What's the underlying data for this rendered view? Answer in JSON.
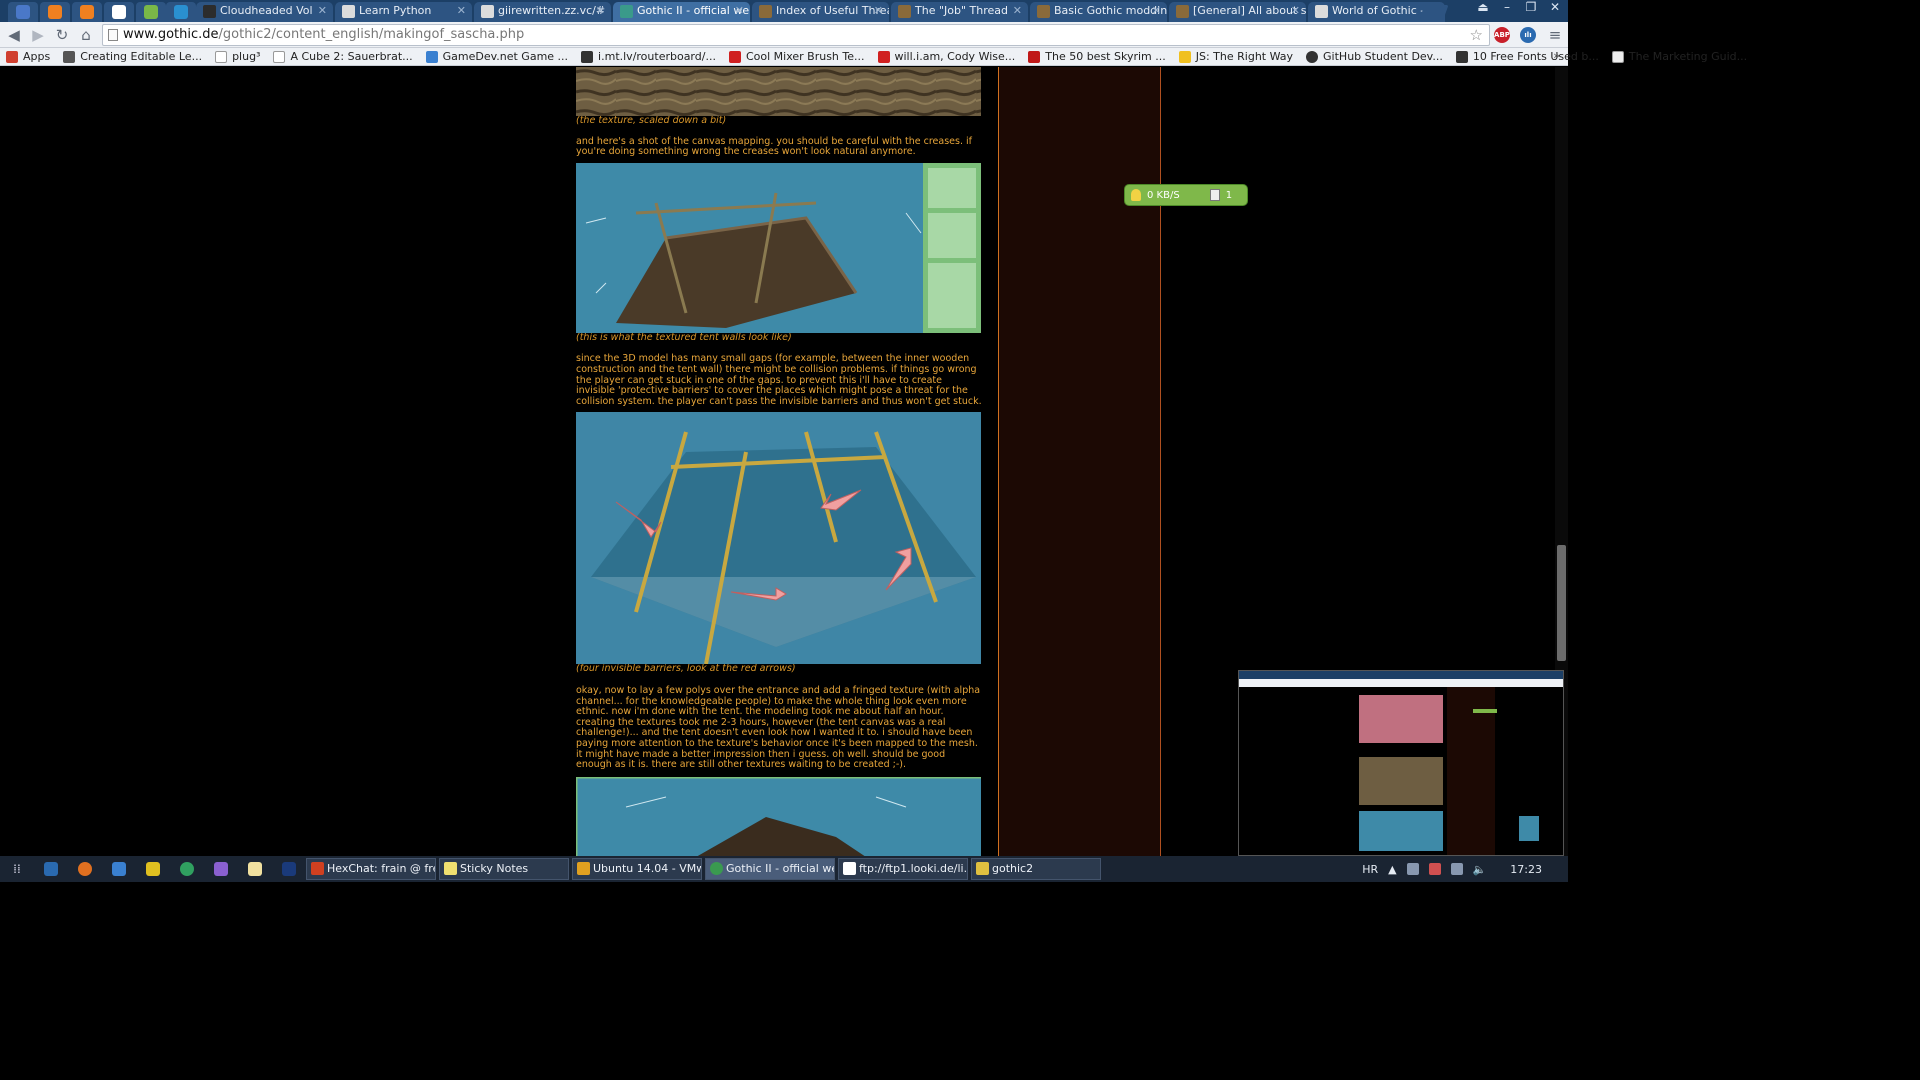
{
  "browser": {
    "pinned_tab_colors": [
      "#4a78c8",
      "#f08020",
      "#f08020",
      "#ffffff",
      "#7ab848",
      "#2a90d0"
    ],
    "tabs": [
      {
        "title": "Cloudheaded Vol",
        "color": "#2c2c2c",
        "active": false
      },
      {
        "title": "Learn Python",
        "color": "#dcdcdc",
        "active": false
      },
      {
        "title": "giirewritten.zz.vc/#",
        "color": "#dcdcdc",
        "active": false
      },
      {
        "title": "Gothic II - official we",
        "color": "#3a9a8a",
        "active": true
      },
      {
        "title": "Index of Useful Threa",
        "color": "#8a6a3a",
        "active": false
      },
      {
        "title": "The \"Job\" Thread",
        "color": "#8a6a3a",
        "active": false
      },
      {
        "title": "Basic Gothic moddin",
        "color": "#8a6a3a",
        "active": false
      },
      {
        "title": "[General] All about s",
        "color": "#8a6a3a",
        "active": false
      },
      {
        "title": "World of Gothic - Do",
        "color": "#dcdcdc",
        "active": false
      }
    ],
    "url_host": "www.gothic.de",
    "url_path": "/gothic2/content_english/makingof_sascha.php",
    "extensions": [
      {
        "label": "ABP",
        "color": "#c8202a"
      },
      {
        "label": "ılı",
        "color": "#2a6ab0"
      }
    ],
    "bookmarks": [
      {
        "label": "Apps",
        "color": "#d04030"
      },
      {
        "label": "Creating Editable Le...",
        "color": "#555555"
      },
      {
        "label": "plug³",
        "color": "#ffffff"
      },
      {
        "label": "A Cube 2: Sauerbrat...",
        "color": "#ffffff"
      },
      {
        "label": "GameDev.net Game ...",
        "color": "#3a80d0"
      },
      {
        "label": "i.mt.lv/routerboard/...",
        "color": "#333333"
      },
      {
        "label": "Cool Mixer Brush Te...",
        "color": "#d02020"
      },
      {
        "label": "will.i.am, Cody Wise...",
        "color": "#d02020"
      },
      {
        "label": "The 50 best Skyrim ...",
        "color": "#c01818"
      },
      {
        "label": "JS: The Right Way",
        "color": "#f0c020"
      },
      {
        "label": "GitHub Student Dev...",
        "color": "#333333"
      },
      {
        "label": "10 Free Fonts Used b...",
        "color": "#333333"
      },
      {
        "label": "The Marketing Guid...",
        "color": "#eeeeee"
      }
    ],
    "bookmarks_more": "»"
  },
  "article": {
    "caption1": "(the texture, scaled down a bit)",
    "para1": "and here's a shot of the canvas mapping. you should be careful with the creases. if you're doing something wrong the creases won't look natural anymore.",
    "caption2": "(this is what the textured tent walls look like)",
    "para2": "since the 3D model has many small gaps (for example, between the inner wooden construction and the tent wall) there might be collision problems. if things go wrong the player can get stuck in one of the gaps. to prevent this i'll have to create invisible 'protective barriers' to cover the places which might pose a threat for the collision system. the player can't pass the invisible barriers and thus won't get stuck.",
    "caption3": "(four invisible barriers, look at the red arrows)",
    "para3": "okay, now to lay a few polys over the entrance and add a fringed texture (with alpha channel... for the knowledgeable people) to make the whole thing look even more ethnic. now i'm done with the tent. the modeling took me about half an hour. creating the textures took me 2-3 hours, however (the tent canvas was a real challenge!)... and the tent doesn't even look how I wanted it to. i should have been paying more attention to the texture's behavior once it's been mapped to the mesh. it might have made a better impression then i guess. oh well. should be good enough as it is. there are still other textures waiting to be created ;-)."
  },
  "net_widget": {
    "speed": "0 KB/S",
    "count": "1"
  },
  "taskbar": {
    "pins": [
      "#2a6ab0",
      "#e07020",
      "#3a80d0",
      "#e0c020",
      "#30a060",
      "#8a60d0",
      "#f0e0a0",
      "#1a3a7a"
    ],
    "tasks": [
      {
        "label": "HexChat: frain @ fre...",
        "color": "#d04020",
        "active": false
      },
      {
        "label": "Sticky Notes",
        "color": "#f0e070",
        "active": false
      },
      {
        "label": "Ubuntu 14.04 - VMw...",
        "color": "#e0a020",
        "active": false
      },
      {
        "label": "Gothic II - official we...",
        "color": "#3a9a50",
        "active": true
      },
      {
        "label": "ftp://ftp1.looki.de/li...",
        "color": "#ffffff",
        "active": false
      },
      {
        "label": "gothic2",
        "color": "#e0c040",
        "active": false
      }
    ],
    "lang": "HR",
    "time": "17:23"
  }
}
